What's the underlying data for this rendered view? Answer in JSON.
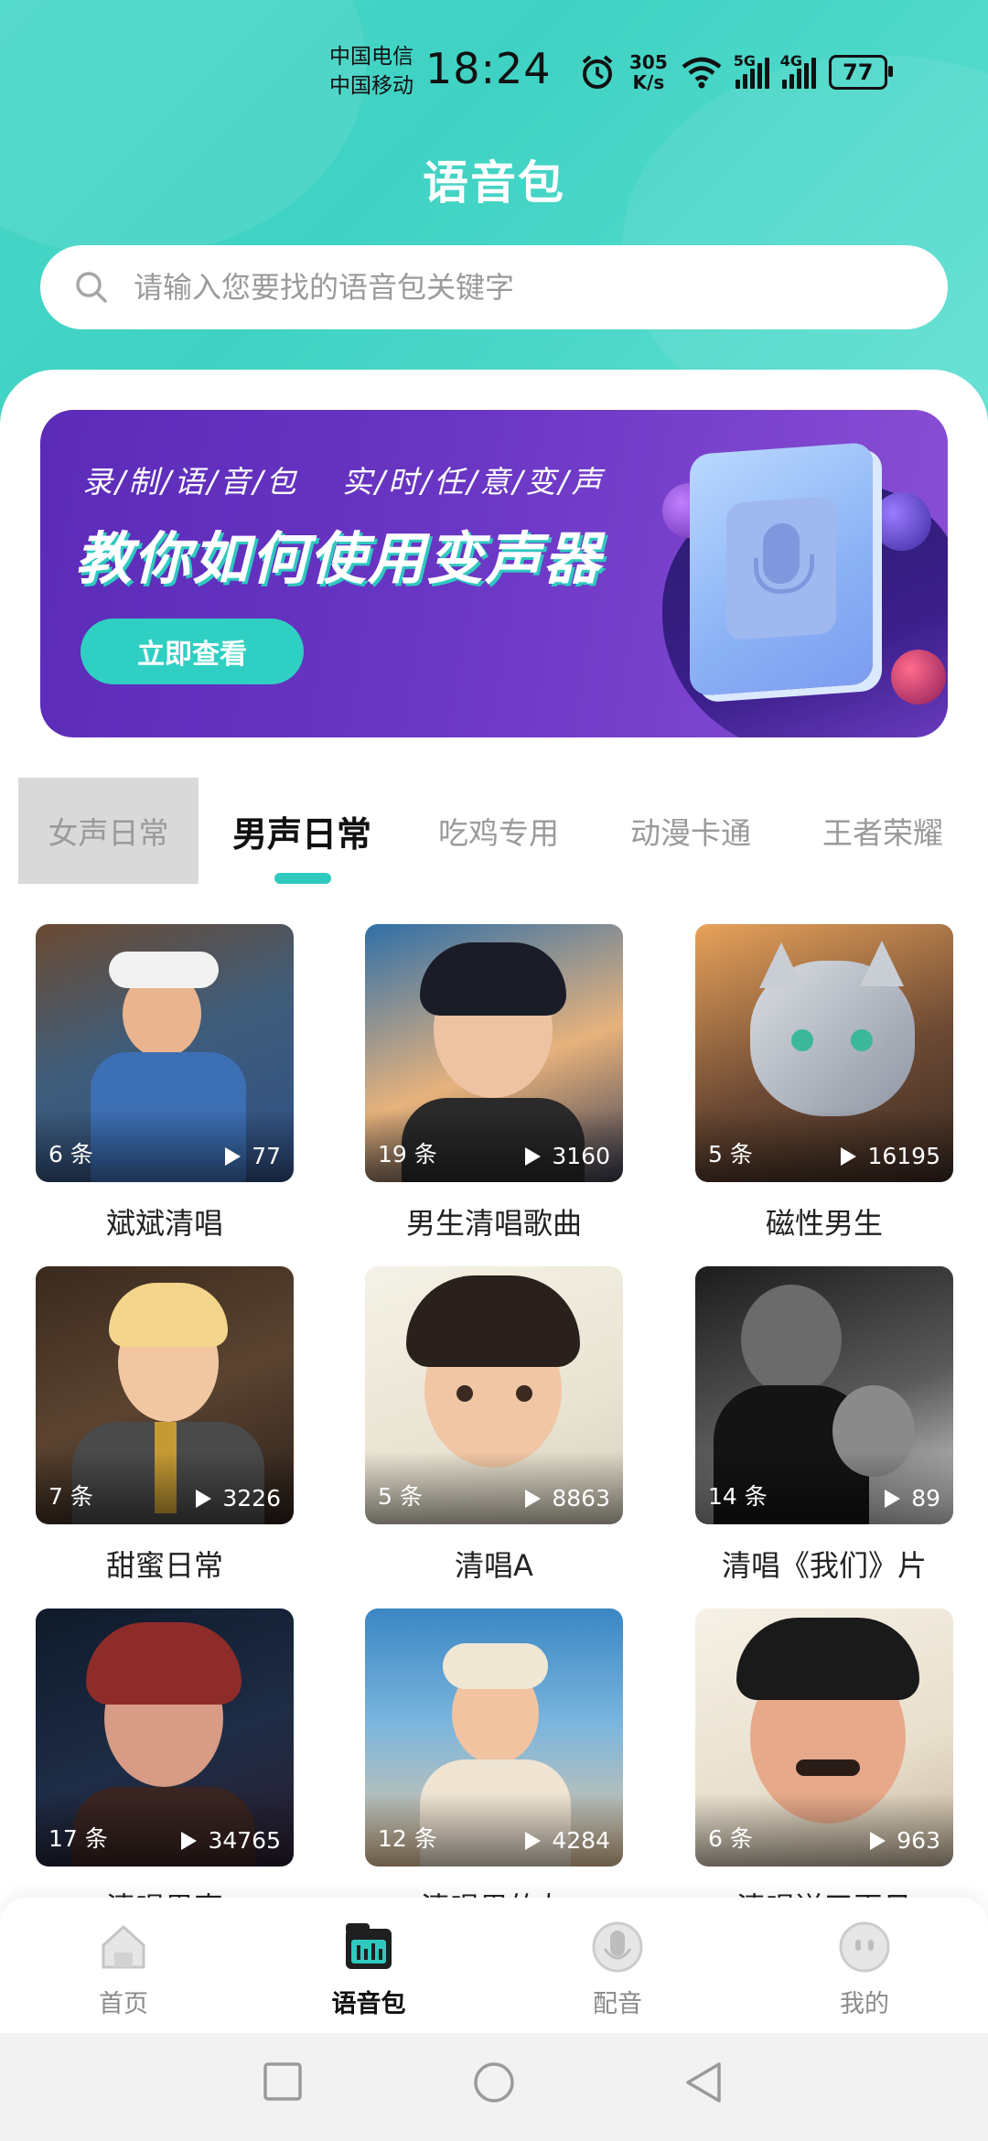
{
  "status_bar": {
    "carrier_1": "中国电信",
    "carrier_2": "中国移动",
    "time": "18:24",
    "speed_value": "305",
    "speed_unit": "K/s",
    "net_1": "5G",
    "net_2": "4G",
    "battery": "77"
  },
  "header": {
    "title": "语音包",
    "search_placeholder": "请输入您要找的语音包关键字"
  },
  "banner": {
    "subtitle_1": "录/制/语/音/包",
    "subtitle_2": "实/时/任/意/变/声",
    "headline": "教你如何使用变声器",
    "button": "立即查看"
  },
  "tabs": [
    {
      "label": "女声日常"
    },
    {
      "label": "男声日常"
    },
    {
      "label": "吃鸡专用"
    },
    {
      "label": "动漫卡通"
    },
    {
      "label": "王者荣耀"
    }
  ],
  "active_tab": "男声日常",
  "packs": [
    {
      "name": "斌斌清唱",
      "count": "6 条",
      "plays": "77"
    },
    {
      "name": "男生清唱歌曲",
      "count": "19 条",
      "plays": "3160"
    },
    {
      "name": "磁性男生",
      "count": "5 条",
      "plays": "16195"
    },
    {
      "name": "甜蜜日常",
      "count": "7 条",
      "plays": "3226"
    },
    {
      "name": "清唱A",
      "count": "5 条",
      "plays": "8863"
    },
    {
      "name": "清唱《我们》片",
      "count": "14 条",
      "plays": "89"
    },
    {
      "name": "清唱男声",
      "count": "17 条",
      "plays": "34765"
    },
    {
      "name": "清唱男的友",
      "count": "12 条",
      "plays": "4284"
    },
    {
      "name": "清唱送了再见",
      "count": "6 条",
      "plays": "963"
    }
  ],
  "bottom_nav": [
    {
      "label": "首页",
      "icon": "home-icon"
    },
    {
      "label": "语音包",
      "icon": "voice-pack-icon"
    },
    {
      "label": "配音",
      "icon": "microphone-icon"
    },
    {
      "label": "我的",
      "icon": "profile-icon"
    }
  ],
  "colors": {
    "accent": "#2fc9bf",
    "banner": "#6a36c4"
  }
}
